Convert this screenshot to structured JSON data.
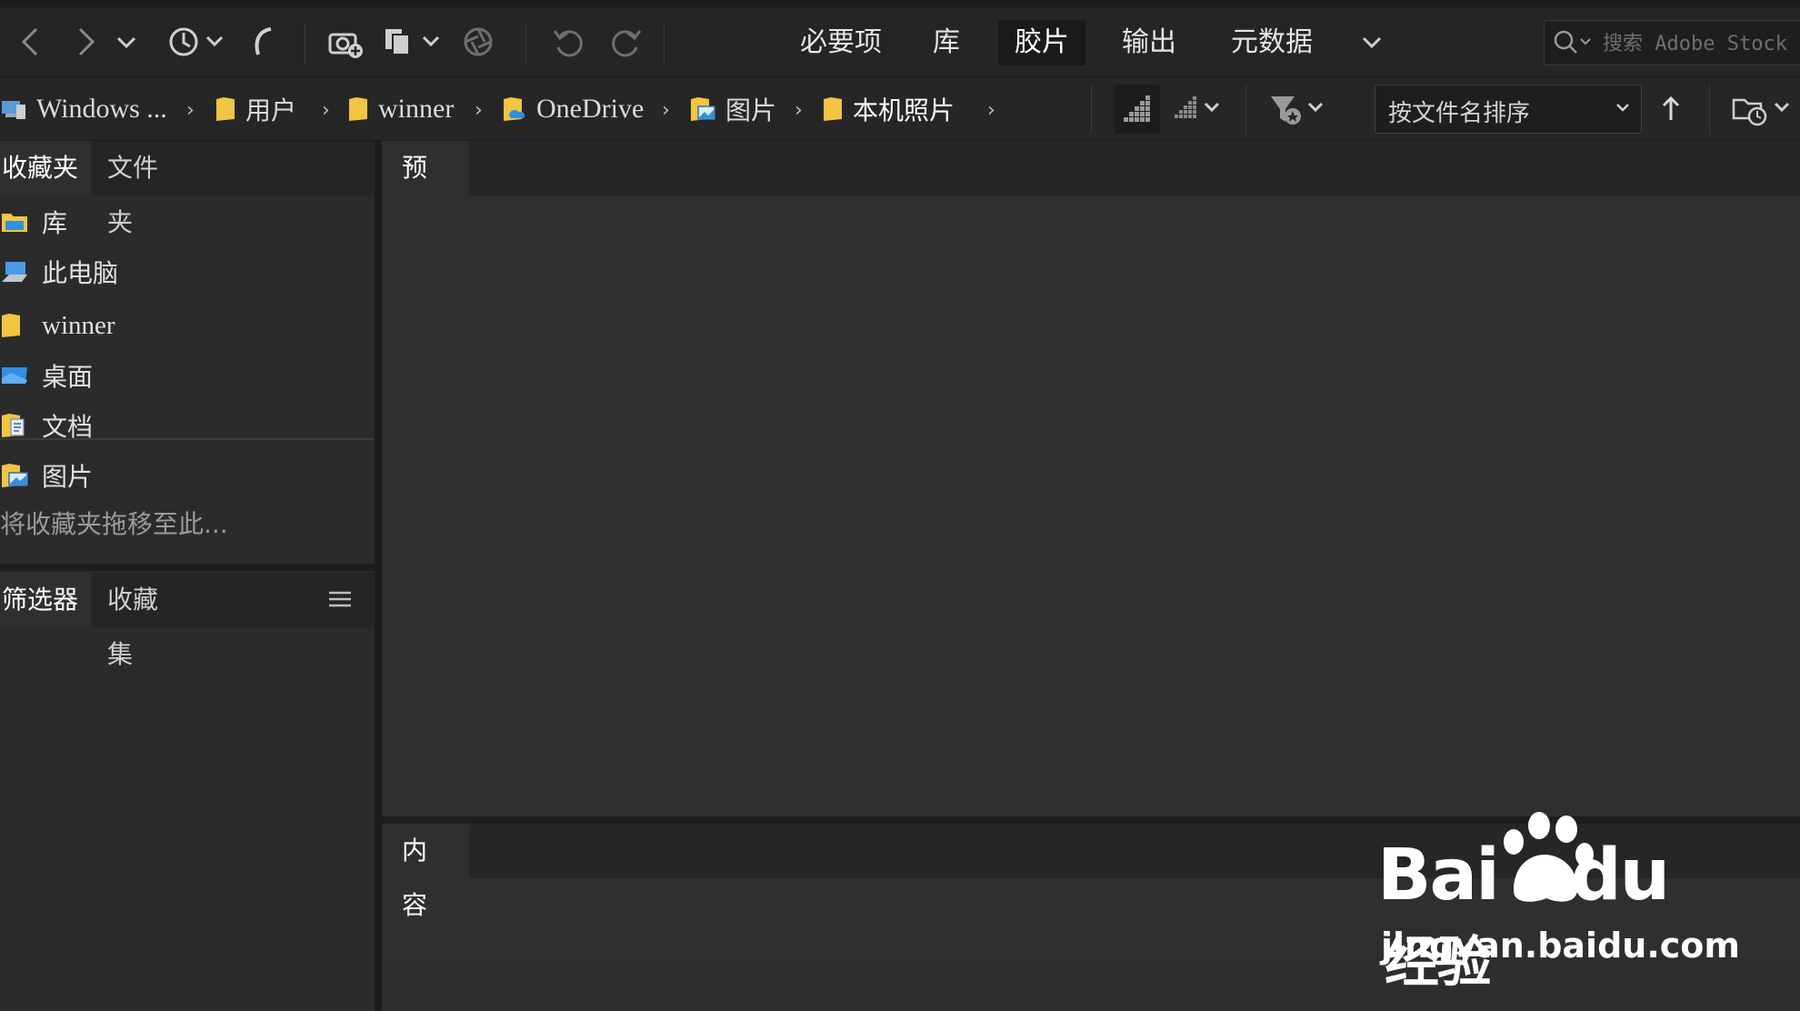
{
  "toolbar": {
    "workspace_tabs": [
      "必要项",
      "库",
      "胶片",
      "输出",
      "元数据"
    ],
    "active_workspace": "胶片",
    "search_placeholder": "搜索 Adobe Stock"
  },
  "path": {
    "crumbs": [
      "Windows ...",
      "用户",
      "winner",
      "OneDrive",
      "图片",
      "本机照片"
    ],
    "sort_label": "按文件名排序"
  },
  "left_panel": {
    "tabs": [
      "收藏夹",
      "文件夹"
    ],
    "favorites": [
      "库",
      "此电脑"
    ],
    "folders": [
      "winner",
      "桌面",
      "文档",
      "图片"
    ],
    "drop_hint": "将收藏夹拖移至此...",
    "lower_tabs": [
      "筛选器",
      "收藏集"
    ]
  },
  "right_panel": {
    "preview_title": "预览",
    "content_title": "内容"
  },
  "watermark": {
    "brand": "Bai",
    "brand_du": "du",
    "brand_cn": "经验",
    "url": "jingyan.baidu.com"
  },
  "colors": {
    "bg": "#2b2b2b",
    "toolbar": "#252525",
    "folder_yellow": "#f2c443",
    "desktop_blue": "#2f8fe0"
  }
}
